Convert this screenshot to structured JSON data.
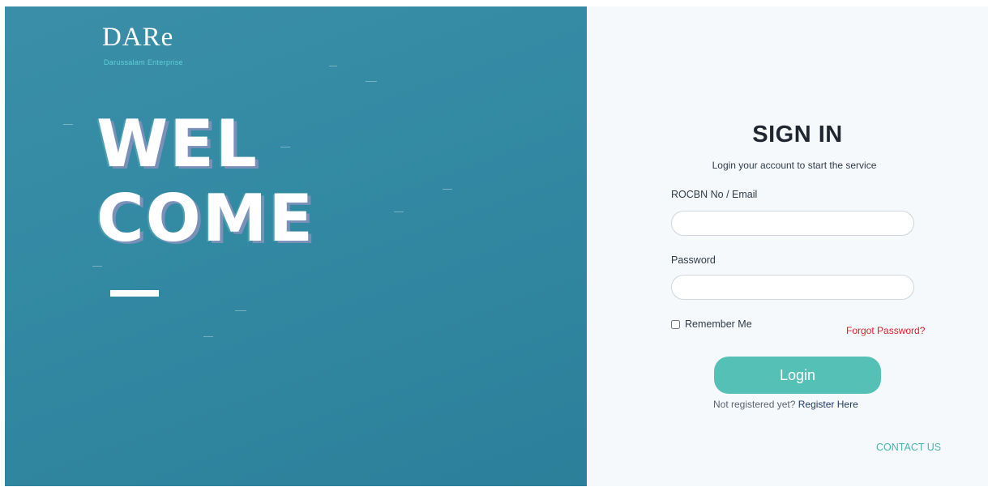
{
  "brand": {
    "logo_text": "DARe",
    "tagline": "Darussalam Enterprise"
  },
  "hero": {
    "line1": "WEL",
    "line2": "COME"
  },
  "signin": {
    "title": "SIGN IN",
    "subtitle": "Login your account to start the service",
    "username_label": "ROCBN No / Email",
    "username_value": "",
    "password_label": "Password",
    "password_value": "",
    "remember_label": "Remember Me",
    "forgot_label": "Forgot Password?",
    "login_label": "Login",
    "register_prompt": "Not registered yet?",
    "register_link": "Register Here",
    "contact_label": "CONTACT US"
  },
  "colors": {
    "panel": "#338aa3",
    "accent": "#55c1b6",
    "forgot": "#e21c2a",
    "contact": "#49b3ad"
  }
}
